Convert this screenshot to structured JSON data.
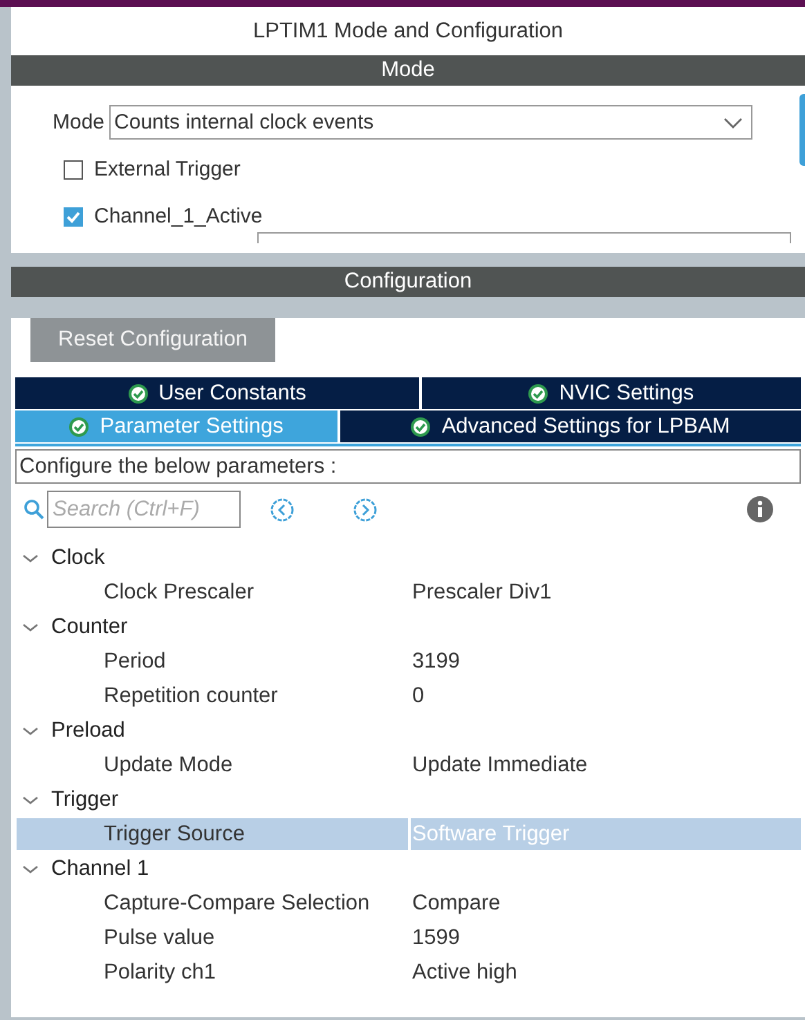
{
  "window": {
    "title": "LPTIM1 Mode and Configuration"
  },
  "mode_section": {
    "header": "Mode",
    "mode_label": "Mode",
    "mode_value": "Counts internal clock events",
    "checkboxes": [
      {
        "label": "External Trigger",
        "checked": false
      },
      {
        "label": "Channel_1_Active",
        "checked": true
      }
    ]
  },
  "configuration": {
    "header": "Configuration",
    "reset_button": "Reset Configuration",
    "tab_rows": [
      [
        {
          "label": "User Constants",
          "selected": false
        },
        {
          "label": "NVIC Settings",
          "selected": false
        }
      ],
      [
        {
          "label": "Parameter Settings",
          "selected": true
        },
        {
          "label": "Advanced Settings for LPBAM",
          "selected": false
        }
      ]
    ],
    "hint": "Configure the below parameters :",
    "search": {
      "placeholder": "Search (Ctrl+F)"
    },
    "tree": [
      {
        "name": "Clock",
        "expanded": true,
        "children": [
          {
            "name": "Clock Prescaler",
            "value": "Prescaler Div1",
            "selected": false
          }
        ]
      },
      {
        "name": "Counter",
        "expanded": true,
        "children": [
          {
            "name": "Period",
            "value": "3199",
            "selected": false
          },
          {
            "name": "Repetition counter",
            "value": "0",
            "selected": false
          }
        ]
      },
      {
        "name": "Preload",
        "expanded": true,
        "children": [
          {
            "name": "Update Mode",
            "value": "Update Immediate",
            "selected": false
          }
        ]
      },
      {
        "name": "Trigger",
        "expanded": true,
        "children": [
          {
            "name": "Trigger Source",
            "value": "Software Trigger",
            "selected": true
          }
        ]
      },
      {
        "name": "Channel 1",
        "expanded": true,
        "children": [
          {
            "name": "Capture-Compare Selection",
            "value": "Compare",
            "selected": false
          },
          {
            "name": "Pulse value",
            "value": "1599",
            "selected": false
          },
          {
            "name": "Polarity ch1",
            "value": "Active high",
            "selected": false
          }
        ]
      }
    ]
  }
}
